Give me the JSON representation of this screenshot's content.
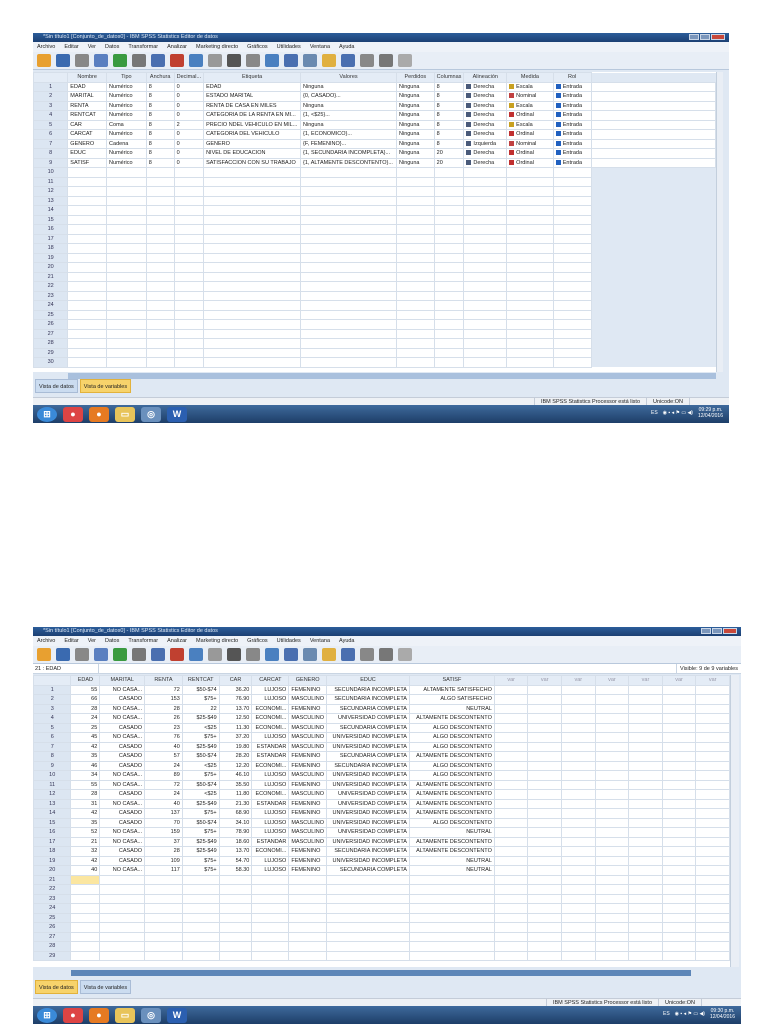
{
  "window": {
    "title": "*Sin título1 [Conjunto_de_datos0] - IBM SPSS Statistics Editor de datos"
  },
  "menu": [
    "Archivo",
    "Editar",
    "Ver",
    "Datos",
    "Transformar",
    "Analizar",
    "Marketing directo",
    "Gráficos",
    "Utilidades",
    "Ventana",
    "Ayuda"
  ],
  "toolbar_icons": [
    "open-icon",
    "save-icon",
    "print-icon",
    "dialog-recall-icon",
    "undo-icon",
    "redo-icon",
    "goto-case-icon",
    "goto-variable-icon",
    "variables-icon",
    "run-icon",
    "find-icon",
    "insert-cases-icon",
    "insert-variable-icon",
    "split-file-icon",
    "weight-cases-icon",
    "select-cases-icon",
    "value-labels-icon",
    "use-sets-icon",
    "show-all-icon",
    "spelling-icon"
  ],
  "variable_view": {
    "columns": [
      "Nombre",
      "Tipo",
      "Anchura",
      "Decimal...",
      "Etiqueta",
      "Valores",
      "Perdidos",
      "Columnas",
      "Alineación",
      "Medida",
      "Rol"
    ],
    "rows": [
      [
        "EDAD",
        "Numérico",
        "8",
        "0",
        "EDAD",
        "Ninguna",
        "Ninguna",
        "8",
        "Derecha",
        "Escala",
        "Entrada"
      ],
      [
        "MARITAL",
        "Numérico",
        "8",
        "0",
        "ESTADO MARITAL",
        "{0, CASADO}...",
        "Ninguna",
        "8",
        "Derecha",
        "Nominal",
        "Entrada"
      ],
      [
        "RENTA",
        "Numérico",
        "8",
        "0",
        "RENTA DE CASA EN MILES",
        "Ninguna",
        "Ninguna",
        "8",
        "Derecha",
        "Escala",
        "Entrada"
      ],
      [
        "RENTCAT",
        "Numérico",
        "8",
        "0",
        "CATEGORIA DE LA RENTA EN MI...",
        "{1, <$25}...",
        "Ninguna",
        "8",
        "Derecha",
        "Ordinal",
        "Entrada"
      ],
      [
        "CAR",
        "Coma",
        "8",
        "2",
        "PRECIO NDEL VEHICULO EN MIL...",
        "Ninguna",
        "Ninguna",
        "8",
        "Derecha",
        "Escala",
        "Entrada"
      ],
      [
        "CARCAT",
        "Numérico",
        "8",
        "0",
        "CATEGORIA DEL VEHICULO",
        "{1, ECONOMICO}...",
        "Ninguna",
        "8",
        "Derecha",
        "Ordinal",
        "Entrada"
      ],
      [
        "GENERO",
        "Cadena",
        "8",
        "0",
        "GENERO",
        "{F, FEMENINO}...",
        "Ninguna",
        "8",
        "Izquierda",
        "Nominal",
        "Entrada"
      ],
      [
        "EDUC",
        "Numérico",
        "8",
        "0",
        "NIVEL DE EDUCACION",
        "{1, SECUNDARIA INCOMPLETA}...",
        "Ninguna",
        "20",
        "Derecha",
        "Ordinal",
        "Entrada"
      ],
      [
        "SATISF",
        "Numérico",
        "8",
        "0",
        "SATISFACCION CON SU TRABAJO",
        "{1, ALTAMENTE DESCONTENTO}...",
        "Ninguna",
        "20",
        "Derecha",
        "Ordinal",
        "Entrada"
      ]
    ],
    "row_count": 30,
    "colors": {
      "Escala": "#c8a020",
      "Nominal": "#c04040",
      "Ordinal": "#c03030",
      "Entrada": "#2060c0"
    }
  },
  "data_view": {
    "cell_ref": "21 : EDAD",
    "visible": "Visible: 9 de 9 variables",
    "columns": [
      "EDAD",
      "MARITAL",
      "RENTA",
      "RENTCAT",
      "CAR",
      "CARCAT",
      "GENERO",
      "EDUC",
      "SATISF",
      "var",
      "var",
      "var",
      "var",
      "var",
      "var",
      "var"
    ],
    "rows": [
      [
        "55",
        "NO CASA...",
        "72",
        "$50-$74",
        "36.20",
        "LUJOSO",
        "FEMENINO",
        "SECUNDARIA INCOMPLETA",
        "ALTAMENTE SATISFECHO"
      ],
      [
        "66",
        "CASADO",
        "153",
        "$75+",
        "76.90",
        "LUJOSO",
        "MASCULINO",
        "SECUNDARIA INCOMPLETA",
        "ALGO SATISFECHO"
      ],
      [
        "28",
        "NO CASA...",
        "28",
        "22",
        "13.70",
        "ECONOMI...",
        "FEMENINO",
        "SECUNDARIA COMPLETA",
        "NEUTRAL"
      ],
      [
        "24",
        "NO CASA...",
        "26",
        "$25-$49",
        "12.50",
        "ECONOMI...",
        "MASCULINO",
        "UNIVERSIDAD COMPLETA",
        "ALTAMENTE DESCONTENTO"
      ],
      [
        "25",
        "CASADO",
        "23",
        "<$25",
        "11.30",
        "ECONOMI...",
        "MASCULINO",
        "SECUNDARIA COMPLETA",
        "ALGO DESCONTENTO"
      ],
      [
        "45",
        "NO CASA...",
        "76",
        "$75+",
        "37.20",
        "LUJOSO",
        "MASCULINO",
        "UNIVERSIDAD INCOMPLETA",
        "ALGO DESCONTENTO"
      ],
      [
        "42",
        "CASADO",
        "40",
        "$25-$49",
        "19.80",
        "ESTANDAR",
        "MASCULINO",
        "UNIVERSIDAD INCOMPLETA",
        "ALGO DESCONTENTO"
      ],
      [
        "35",
        "CASADO",
        "57",
        "$50-$74",
        "28.20",
        "ESTANDAR",
        "FEMENINO",
        "SECUNDARIA COMPLETA",
        "ALTAMENTE DESCONTENTO"
      ],
      [
        "46",
        "CASADO",
        "24",
        "<$25",
        "12.20",
        "ECONOMI...",
        "FEMENINO",
        "SECUNDARIA INCOMPLETA",
        "ALGO DESCONTENTO"
      ],
      [
        "34",
        "NO CASA...",
        "89",
        "$75+",
        "46.10",
        "LUJOSO",
        "MASCULINO",
        "UNIVERSIDAD INCOMPLETA",
        "ALGO DESCONTENTO"
      ],
      [
        "55",
        "NO CASA...",
        "72",
        "$50-$74",
        "35.50",
        "LUJOSO",
        "FEMENINO",
        "UNIVERSIDAD INCOMPLETA",
        "ALTAMENTE DESCONTENTO"
      ],
      [
        "28",
        "CASADO",
        "24",
        "<$25",
        "11.80",
        "ECONOMI...",
        "MASCULINO",
        "UNIVERSIDAD COMPLETA",
        "ALTAMENTE DESCONTENTO"
      ],
      [
        "31",
        "NO CASA...",
        "40",
        "$25-$49",
        "21.30",
        "ESTANDAR",
        "FEMENINO",
        "UNIVERSIDAD COMPLETA",
        "ALTAMENTE DESCONTENTO"
      ],
      [
        "42",
        "CASADO",
        "137",
        "$75+",
        "68.90",
        "LUJOSO",
        "FEMENINO",
        "UNIVERSIDAD INCOMPLETA",
        "ALTAMENTE DESCONTENTO"
      ],
      [
        "35",
        "CASADO",
        "70",
        "$50-$74",
        "34.10",
        "LUJOSO",
        "MASCULINO",
        "UNIVERSIDAD INCOMPLETA",
        "ALGO DESCONTENTO"
      ],
      [
        "52",
        "NO CASA...",
        "159",
        "$75+",
        "78.90",
        "LUJOSO",
        "MASCULINO",
        "UNIVERSIDAD COMPLETA",
        "NEUTRAL"
      ],
      [
        "21",
        "NO CASA...",
        "37",
        "$25-$49",
        "18.60",
        "ESTANDAR",
        "MASCULINO",
        "UNIVERSIDAD INCOMPLETA",
        "ALTAMENTE DESCONTENTO"
      ],
      [
        "32",
        "CASADO",
        "28",
        "$25-$49",
        "13.70",
        "ECONOMI...",
        "FEMENINO",
        "SECUNDARIA INCOMPLETA",
        "ALTAMENTE DESCONTENTO"
      ],
      [
        "42",
        "CASADO",
        "109",
        "$75+",
        "54.70",
        "LUJOSO",
        "FEMENINO",
        "UNIVERSIDAD INCOMPLETA",
        "NEUTRAL"
      ],
      [
        "40",
        "NO CASA...",
        "117",
        "$75+",
        "58.30",
        "LUJOSO",
        "FEMENINO",
        "SECUNDARIA COMPLETA",
        "NEUTRAL"
      ]
    ],
    "row_count": 29
  },
  "tabs": {
    "data": "Vista de datos",
    "variables": "Vista de variables"
  },
  "status": {
    "processor": "IBM SPSS Statistics Processor está listo",
    "unicode": "Unicode:ON"
  },
  "taskbar": {
    "lang": "ES",
    "top": {
      "time": "09:29 p.m.",
      "date": "12/04/2016"
    },
    "bottom": {
      "time": "09:30 p.m.",
      "date": "12/04/2016"
    }
  }
}
